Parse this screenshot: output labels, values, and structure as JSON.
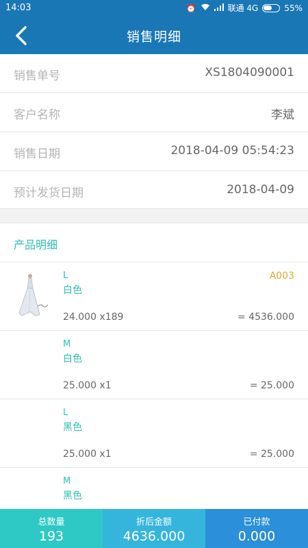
{
  "status": {
    "time": "14:03",
    "carrier": "联通 4G",
    "battery": "55%"
  },
  "header": {
    "title": "销售明细"
  },
  "info": [
    {
      "label": "销售单号",
      "value": "XS1804090001"
    },
    {
      "label": "客户名称",
      "value": "李斌"
    },
    {
      "label": "销售日期",
      "value": "2018-04-09 05:54:23"
    },
    {
      "label": "预计发货日期",
      "value": "2018-04-09"
    }
  ],
  "products": {
    "title": "产品明细",
    "items": [
      {
        "size": "L",
        "color": "白色",
        "code": "A003",
        "qty": "24.000 x189",
        "amount": "= 4536.000"
      },
      {
        "size": "M",
        "color": "白色",
        "code": "",
        "qty": "25.000 x1",
        "amount": "= 25.000"
      },
      {
        "size": "L",
        "color": "黑色",
        "code": "",
        "qty": "25.000 x1",
        "amount": "= 25.000"
      },
      {
        "size": "M",
        "color": "黑色",
        "code": "",
        "qty": "",
        "amount": ""
      }
    ]
  },
  "footer": {
    "total_qty_label": "总数量",
    "total_qty": "193",
    "discount_label": "折后金额",
    "discount_amount": "4636.000",
    "paid_label": "已付款",
    "paid": "0.000"
  }
}
